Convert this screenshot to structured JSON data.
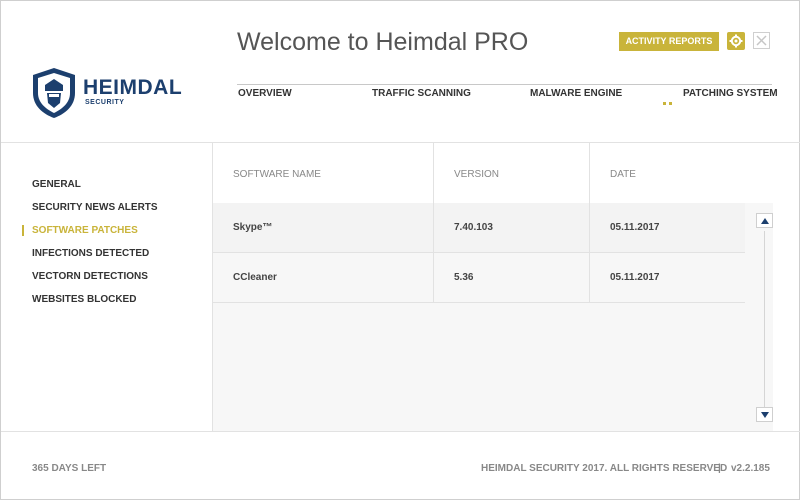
{
  "app": {
    "title": "Welcome to Heimdal  PRO",
    "logo_name": "HEIMDAL",
    "logo_sub": "SECURITY",
    "brand_color": "#1c3f6e",
    "accent_color": "#c9b43a"
  },
  "toolbar": {
    "reports_label": "ACTIVITY REPORTS",
    "settings_icon": "gear-icon",
    "close_icon": "close-icon"
  },
  "tabs": [
    {
      "label": "OVERVIEW"
    },
    {
      "label": "TRAFFIC SCANNING"
    },
    {
      "label": "MALWARE ENGINE"
    },
    {
      "label": "PATCHING SYSTEM",
      "active": true
    }
  ],
  "sidebar": {
    "items": [
      {
        "label": "GENERAL"
      },
      {
        "label": "SECURITY NEWS ALERTS"
      },
      {
        "label": "SOFTWARE PATCHES",
        "active": true
      },
      {
        "label": "INFECTIONS DETECTED"
      },
      {
        "label": "VECTORN DETECTIONS"
      },
      {
        "label": "WEBSITES BLOCKED"
      }
    ]
  },
  "table": {
    "headers": [
      "SOFTWARE NAME",
      "VERSION",
      "DATE"
    ],
    "rows": [
      {
        "name": "Skype™",
        "version": "7.40.103",
        "date": "05.11.2017"
      },
      {
        "name": "CCleaner",
        "version": "5.36",
        "date": "05.11.2017"
      }
    ]
  },
  "footer": {
    "days_left": "365 DAYS LEFT",
    "copyright": "HEIMDAL SECURITY 2017. ALL RIGHTS RESERVED",
    "separator": "|",
    "version": "v2.2.185"
  }
}
